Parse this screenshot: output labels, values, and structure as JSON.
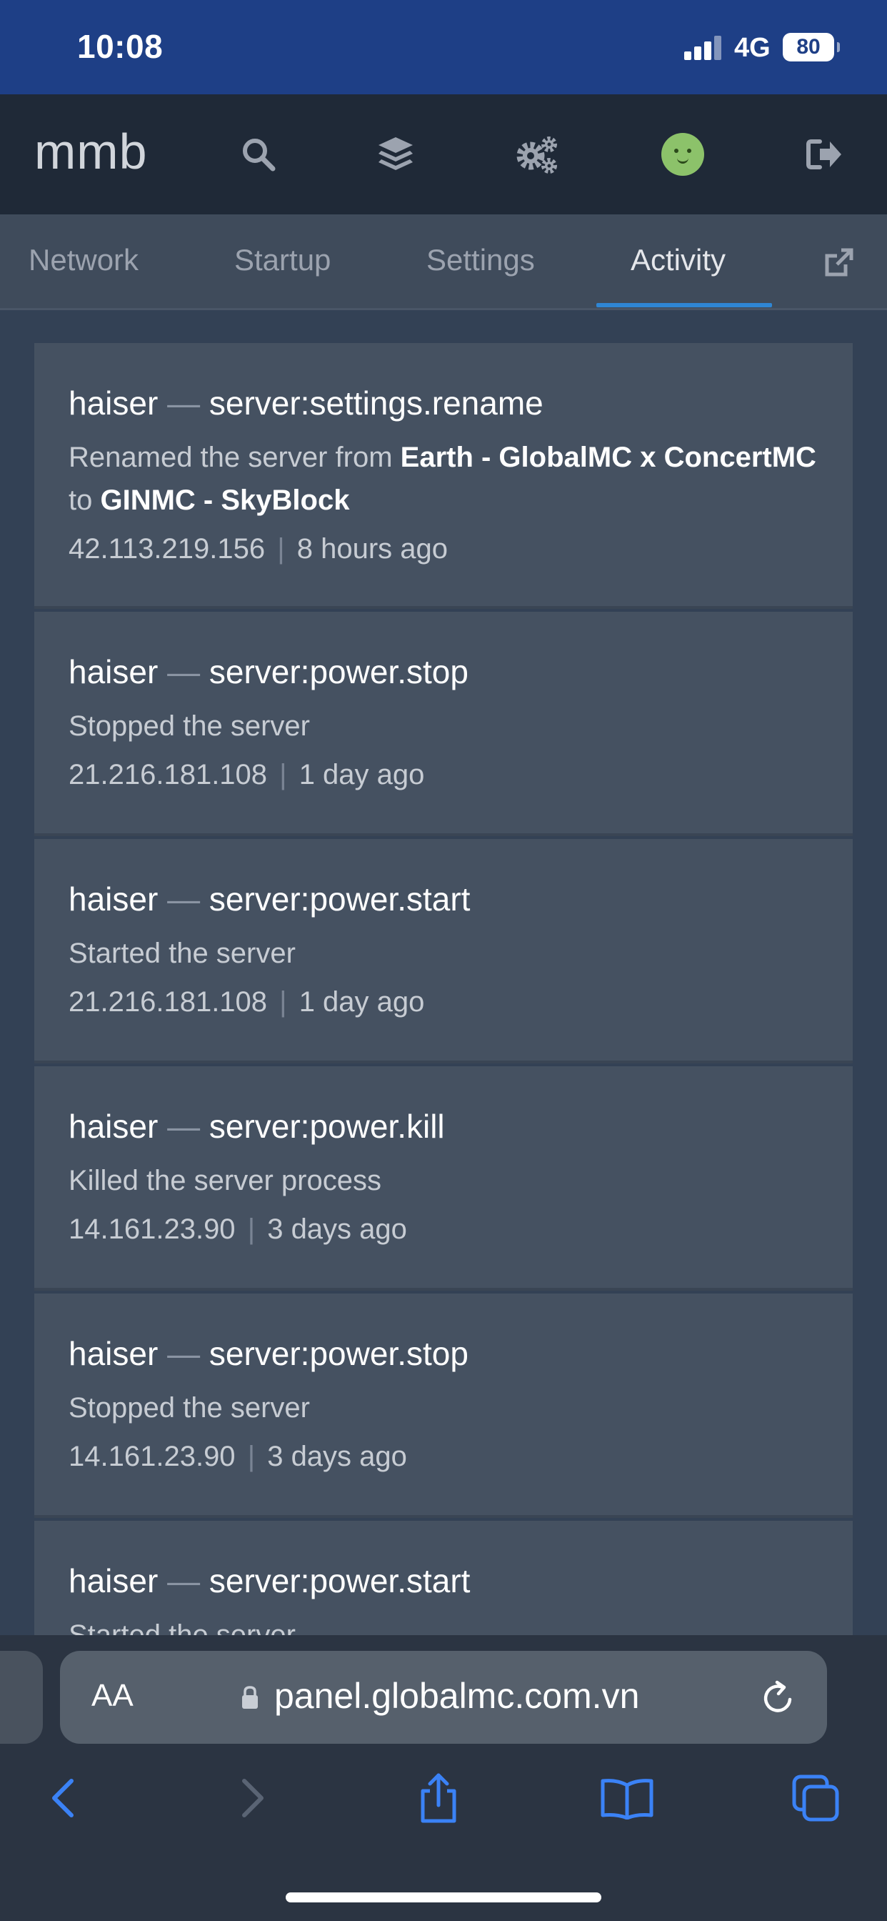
{
  "status_bar": {
    "time": "10:08",
    "network": "4G",
    "battery": "80"
  },
  "header": {
    "brand": "mmb",
    "icons": [
      "search-icon",
      "layers-icon",
      "cogs-icon",
      "avatar",
      "logout-icon"
    ]
  },
  "tabs": {
    "items": [
      {
        "label": "Network"
      },
      {
        "label": "Startup"
      },
      {
        "label": "Settings"
      },
      {
        "label": "Activity"
      }
    ],
    "active": "Activity",
    "accent_color": "#2f86d4"
  },
  "activity": {
    "dash": "—",
    "separator": "|",
    "entries": [
      {
        "user": "haiser",
        "event": "server:settings.rename",
        "desc_prefix": "Renamed the server from ",
        "desc_from": "Earth - GlobalMC x ConcertMC",
        "desc_mid": " to ",
        "desc_to": "GINMC - SkyBlock",
        "ip": "42.113.219.156",
        "time": "8 hours ago"
      },
      {
        "user": "haiser",
        "event": "server:power.stop",
        "description": "Stopped the server",
        "ip": "21.216.181.108",
        "time": "1 day ago"
      },
      {
        "user": "haiser",
        "event": "server:power.start",
        "description": "Started the server",
        "ip": "21.216.181.108",
        "time": "1 day ago"
      },
      {
        "user": "haiser",
        "event": "server:power.kill",
        "description": "Killed the server process",
        "ip": "14.161.23.90",
        "time": "3 days ago"
      },
      {
        "user": "haiser",
        "event": "server:power.stop",
        "description": "Stopped the server",
        "ip": "14.161.23.90",
        "time": "3 days ago"
      },
      {
        "user": "haiser",
        "event": "server:power.start",
        "description": "Started the server",
        "ip": "",
        "time": ""
      }
    ]
  },
  "browser": {
    "text_size_label": "AA",
    "url": "panel.globalmc.com.vn",
    "toolbar": [
      "back-icon",
      "forward-icon",
      "share-icon",
      "bookmarks-icon",
      "tabs-icon"
    ]
  }
}
